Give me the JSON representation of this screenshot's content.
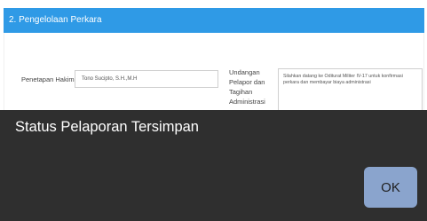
{
  "section": {
    "title": "2. Pengelolaan Perkara"
  },
  "form": {
    "hakim_label": "Penetapan Hakim",
    "hakim_value": "Tono Sucipto, S.H.,M.H",
    "undangan_label_lines": [
      "Undangan",
      "Pelapor dan",
      "Tagihan",
      "Administrasi"
    ],
    "undangan_value": "Silahkan datang ke Oditurat Militer IV-17 untuk konfirmasi perkara dan membayar biaya administrasi"
  },
  "dialog": {
    "message": "Status Pelaporan Tersimpan",
    "ok_label": "OK"
  },
  "colors": {
    "header_bg": "#2f9ae6",
    "dialog_bg": "#2f2f2f",
    "ok_bg": "#8aa4cd"
  }
}
